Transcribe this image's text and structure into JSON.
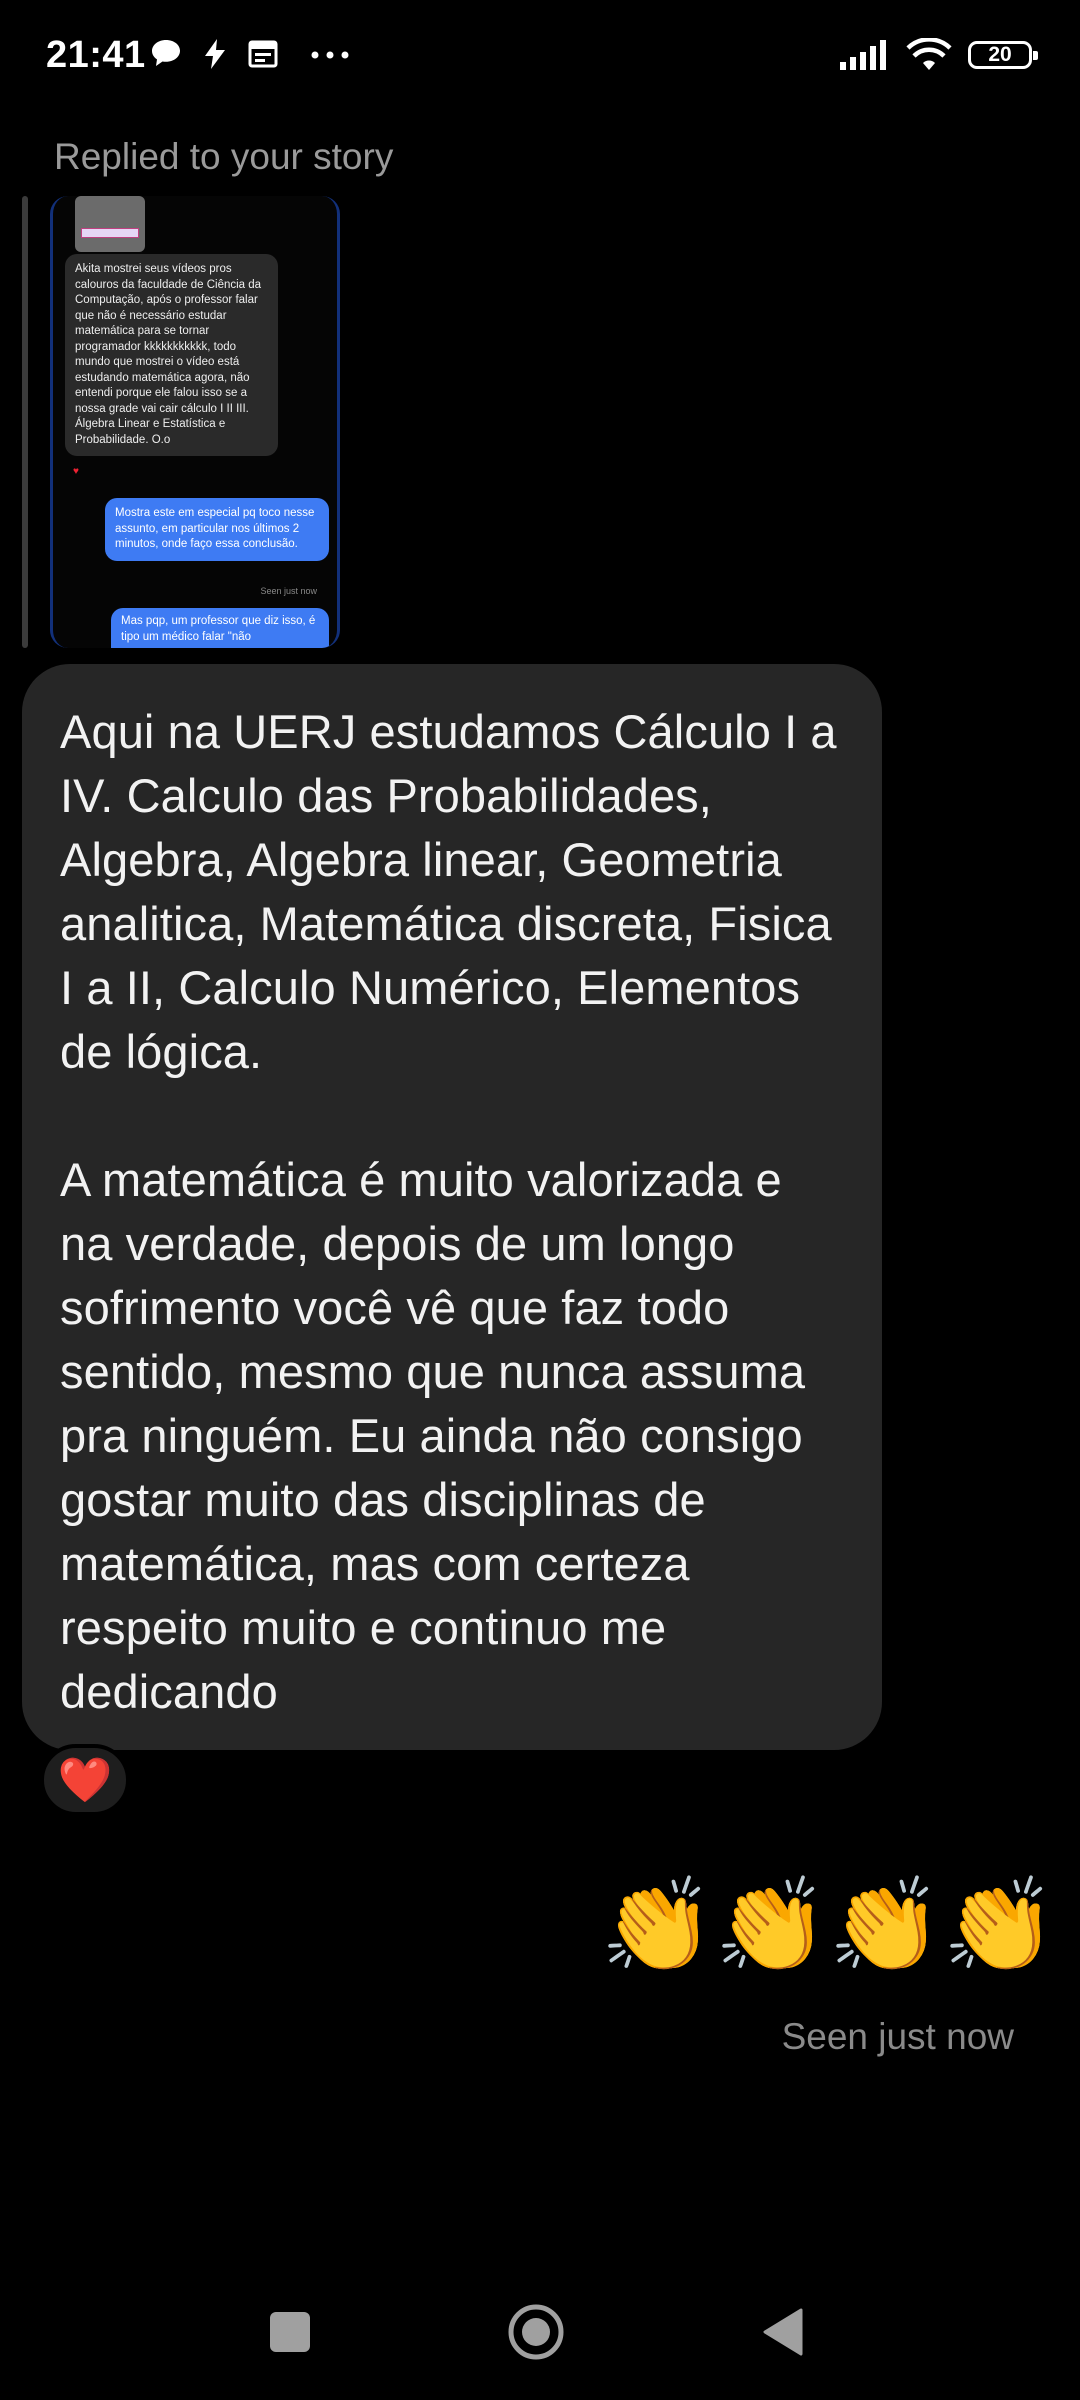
{
  "status_bar": {
    "time": "21:41",
    "left_icons": [
      "chat-bubble-icon",
      "bolt-icon",
      "calendar-icon",
      "more-dots-icon"
    ],
    "battery": "20"
  },
  "replied_label": "Replied to your story",
  "story_preview": {
    "received_text": "Akita mostrei seus vídeos pros calouros da faculdade de Ciência da Computação, após o professor falar que não é necessário estudar matemática para se tornar programador kkkkkkkkkkk, todo mundo que mostrei o vídeo está estudando matemática agora, não entendi porque ele falou isso se a nossa grade vai cair cálculo I II III. Álgebra Linear e Estatística e Probabilidade. O.o",
    "sent_text": "Mostra este em especial pq toco nesse assunto, em particular nos últimos 2 minutos, onde faço essa conclusão.",
    "seen": "Seen just now",
    "sent_text_2": "Mas pqp, um professor que diz isso, é tipo um médico falar \"não"
  },
  "message": {
    "text": "Aqui na UERJ estudamos Cálculo I a IV. Calculo das Probabilidades, Algebra, Algebra linear, Geometria analitica, Matemática discreta, Fisica I a II, Calculo Numérico, Elementos de lógica.\n\nA matemática é muito valorizada e na verdade, depois de um longo sofrimento você vê que faz todo sentido, mesmo que nunca assuma pra ninguém. Eu ainda não consigo gostar muito das disciplinas de matemática, mas com certeza respeito muito e continuo me dedicando",
    "reaction": "❤️"
  },
  "reply": {
    "claps": [
      "👏",
      "👏",
      "👏",
      "👏"
    ],
    "seen": "Seen just now"
  },
  "nav": [
    "recents-square-icon",
    "home-circle-icon",
    "back-triangle-icon"
  ]
}
